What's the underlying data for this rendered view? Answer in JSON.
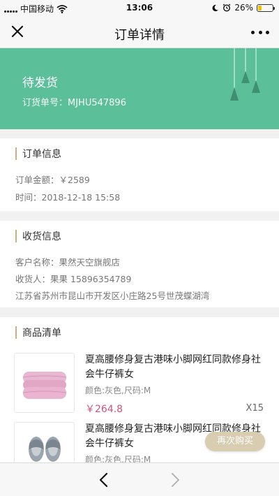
{
  "status_bar": {
    "carrier": "中国移动",
    "time": "13:06",
    "battery": "26%",
    "battery_level": 0.26,
    "icons": [
      "signal-icon",
      "wifi-icon",
      "moon-icon",
      "alarm-icon",
      "battery-icon"
    ]
  },
  "nav": {
    "title": "订单详情",
    "close_icon": "close-icon",
    "more_icon": "more-icon"
  },
  "banner": {
    "status": "待发货",
    "order_no": "订货单号：MJHU547896",
    "color": "#5bbf9a"
  },
  "order_info": {
    "heading": "订单信息",
    "amount": "订单金额：￥2589",
    "time": "时间：2018-12-18  15:58"
  },
  "shipping_info": {
    "heading": "收货信息",
    "customer": "客户名称：果然天空旗舰店",
    "receiver": "收货人：果果    15896354789",
    "address": "江苏省苏州市昆山市开发区小庄路25号世茂蝶湖湾"
  },
  "products": {
    "heading": "商品清单",
    "items": [
      {
        "name": "夏高腰修身复古港味小脚网红同款修身社会牛仔裤女",
        "spec": "颜色:灰色,尺码:M",
        "price": "￥264.8",
        "qty": "X15",
        "image": "towel-image"
      },
      {
        "name": "夏高腰修身复古港味小脚网红同款修身社会牛仔裤女",
        "spec": "颜色:灰色,尺码:M",
        "image": "slippers-image"
      }
    ]
  },
  "actions": {
    "rebuy": "再次购买"
  },
  "bottom_nav": {
    "back_icon": "chevron-left-icon",
    "forward_icon": "chevron-right-icon"
  },
  "colors": {
    "accent_gold": "#c9b07e",
    "price": "#d2527a",
    "rebuy_button": "#d9cdb1"
  }
}
